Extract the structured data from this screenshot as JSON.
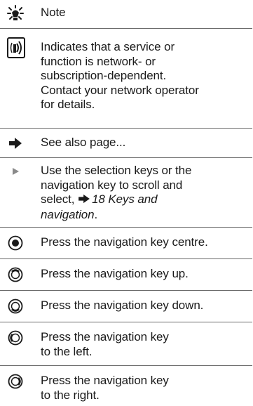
{
  "rows": [
    {
      "icon": "note-bulb-icon",
      "lines": [
        "Note"
      ]
    },
    {
      "icon": "network-operator-icon",
      "lines": [
        "Indicates that a service or",
        "function is network- or",
        "subscription-dependent.",
        "Contact your network operator",
        "for details."
      ]
    },
    {
      "icon": "see-also-arrow-icon",
      "lines": [
        "See also page..."
      ]
    },
    {
      "icon": "selection-triangle-icon",
      "lines": [
        "Use the selection keys or the",
        "navigation key to scroll and",
        "select,"
      ],
      "ref": "18 Keys and",
      "ref2": "navigation",
      "ref_end": "."
    },
    {
      "icon": "nav-key-centre-icon",
      "lines": [
        "Press the navigation key centre."
      ]
    },
    {
      "icon": "nav-key-up-icon",
      "lines": [
        "Press the navigation key up."
      ]
    },
    {
      "icon": "nav-key-down-icon",
      "lines": [
        "Press the navigation key down."
      ]
    },
    {
      "icon": "nav-key-left-icon",
      "lines": [
        "Press the navigation key",
        "to the left."
      ]
    },
    {
      "icon": "nav-key-right-icon",
      "lines": [
        "Press the navigation key",
        "to the right."
      ]
    }
  ]
}
